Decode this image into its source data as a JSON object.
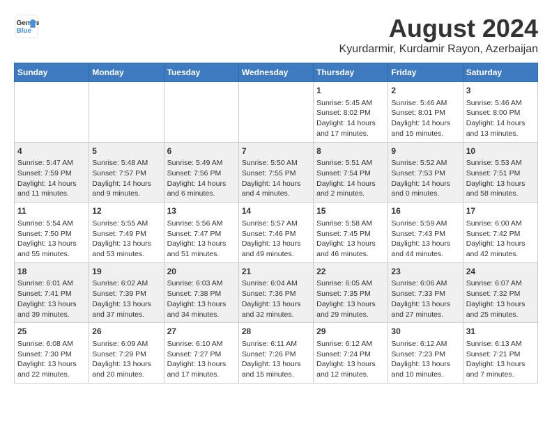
{
  "header": {
    "logo_line1": "General",
    "logo_line2": "Blue",
    "title": "August 2024",
    "subtitle": "Kyurdarmir, Kurdamir Rayon, Azerbaijan"
  },
  "days_of_week": [
    "Sunday",
    "Monday",
    "Tuesday",
    "Wednesday",
    "Thursday",
    "Friday",
    "Saturday"
  ],
  "weeks": [
    [
      {
        "day": "",
        "info": ""
      },
      {
        "day": "",
        "info": ""
      },
      {
        "day": "",
        "info": ""
      },
      {
        "day": "",
        "info": ""
      },
      {
        "day": "1",
        "info": "Sunrise: 5:45 AM\nSunset: 8:02 PM\nDaylight: 14 hours\nand 17 minutes."
      },
      {
        "day": "2",
        "info": "Sunrise: 5:46 AM\nSunset: 8:01 PM\nDaylight: 14 hours\nand 15 minutes."
      },
      {
        "day": "3",
        "info": "Sunrise: 5:46 AM\nSunset: 8:00 PM\nDaylight: 14 hours\nand 13 minutes."
      }
    ],
    [
      {
        "day": "4",
        "info": "Sunrise: 5:47 AM\nSunset: 7:59 PM\nDaylight: 14 hours\nand 11 minutes."
      },
      {
        "day": "5",
        "info": "Sunrise: 5:48 AM\nSunset: 7:57 PM\nDaylight: 14 hours\nand 9 minutes."
      },
      {
        "day": "6",
        "info": "Sunrise: 5:49 AM\nSunset: 7:56 PM\nDaylight: 14 hours\nand 6 minutes."
      },
      {
        "day": "7",
        "info": "Sunrise: 5:50 AM\nSunset: 7:55 PM\nDaylight: 14 hours\nand 4 minutes."
      },
      {
        "day": "8",
        "info": "Sunrise: 5:51 AM\nSunset: 7:54 PM\nDaylight: 14 hours\nand 2 minutes."
      },
      {
        "day": "9",
        "info": "Sunrise: 5:52 AM\nSunset: 7:53 PM\nDaylight: 14 hours\nand 0 minutes."
      },
      {
        "day": "10",
        "info": "Sunrise: 5:53 AM\nSunset: 7:51 PM\nDaylight: 13 hours\nand 58 minutes."
      }
    ],
    [
      {
        "day": "11",
        "info": "Sunrise: 5:54 AM\nSunset: 7:50 PM\nDaylight: 13 hours\nand 55 minutes."
      },
      {
        "day": "12",
        "info": "Sunrise: 5:55 AM\nSunset: 7:49 PM\nDaylight: 13 hours\nand 53 minutes."
      },
      {
        "day": "13",
        "info": "Sunrise: 5:56 AM\nSunset: 7:47 PM\nDaylight: 13 hours\nand 51 minutes."
      },
      {
        "day": "14",
        "info": "Sunrise: 5:57 AM\nSunset: 7:46 PM\nDaylight: 13 hours\nand 49 minutes."
      },
      {
        "day": "15",
        "info": "Sunrise: 5:58 AM\nSunset: 7:45 PM\nDaylight: 13 hours\nand 46 minutes."
      },
      {
        "day": "16",
        "info": "Sunrise: 5:59 AM\nSunset: 7:43 PM\nDaylight: 13 hours\nand 44 minutes."
      },
      {
        "day": "17",
        "info": "Sunrise: 6:00 AM\nSunset: 7:42 PM\nDaylight: 13 hours\nand 42 minutes."
      }
    ],
    [
      {
        "day": "18",
        "info": "Sunrise: 6:01 AM\nSunset: 7:41 PM\nDaylight: 13 hours\nand 39 minutes."
      },
      {
        "day": "19",
        "info": "Sunrise: 6:02 AM\nSunset: 7:39 PM\nDaylight: 13 hours\nand 37 minutes."
      },
      {
        "day": "20",
        "info": "Sunrise: 6:03 AM\nSunset: 7:38 PM\nDaylight: 13 hours\nand 34 minutes."
      },
      {
        "day": "21",
        "info": "Sunrise: 6:04 AM\nSunset: 7:36 PM\nDaylight: 13 hours\nand 32 minutes."
      },
      {
        "day": "22",
        "info": "Sunrise: 6:05 AM\nSunset: 7:35 PM\nDaylight: 13 hours\nand 29 minutes."
      },
      {
        "day": "23",
        "info": "Sunrise: 6:06 AM\nSunset: 7:33 PM\nDaylight: 13 hours\nand 27 minutes."
      },
      {
        "day": "24",
        "info": "Sunrise: 6:07 AM\nSunset: 7:32 PM\nDaylight: 13 hours\nand 25 minutes."
      }
    ],
    [
      {
        "day": "25",
        "info": "Sunrise: 6:08 AM\nSunset: 7:30 PM\nDaylight: 13 hours\nand 22 minutes."
      },
      {
        "day": "26",
        "info": "Sunrise: 6:09 AM\nSunset: 7:29 PM\nDaylight: 13 hours\nand 20 minutes."
      },
      {
        "day": "27",
        "info": "Sunrise: 6:10 AM\nSunset: 7:27 PM\nDaylight: 13 hours\nand 17 minutes."
      },
      {
        "day": "28",
        "info": "Sunrise: 6:11 AM\nSunset: 7:26 PM\nDaylight: 13 hours\nand 15 minutes."
      },
      {
        "day": "29",
        "info": "Sunrise: 6:12 AM\nSunset: 7:24 PM\nDaylight: 13 hours\nand 12 minutes."
      },
      {
        "day": "30",
        "info": "Sunrise: 6:12 AM\nSunset: 7:23 PM\nDaylight: 13 hours\nand 10 minutes."
      },
      {
        "day": "31",
        "info": "Sunrise: 6:13 AM\nSunset: 7:21 PM\nDaylight: 13 hours\nand 7 minutes."
      }
    ]
  ]
}
